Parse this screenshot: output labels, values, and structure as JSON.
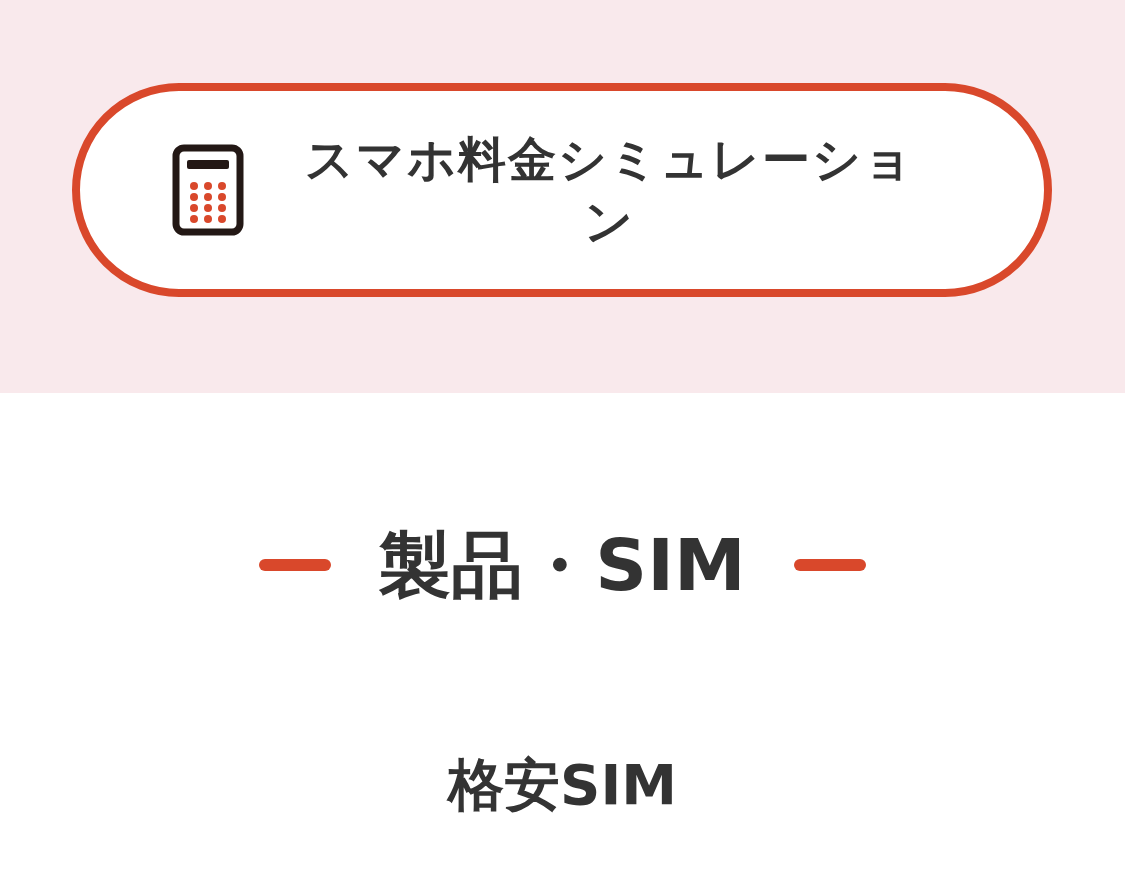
{
  "simulation_button": {
    "label": "スマホ料金シミュレーション"
  },
  "section": {
    "heading": "製品・SIM",
    "subheading": "格安SIM"
  }
}
